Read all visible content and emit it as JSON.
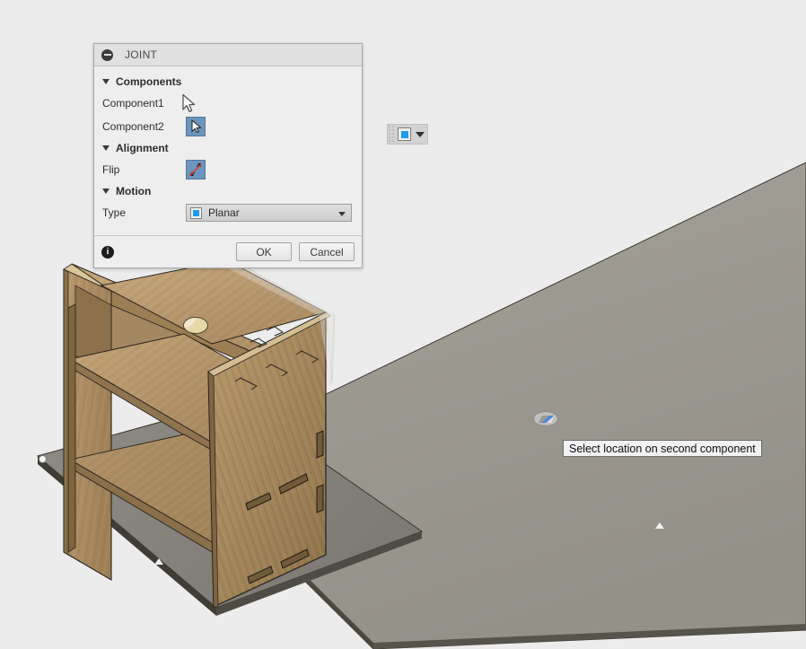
{
  "app": {
    "background_color": "#ececec",
    "viewport_name": "3d-viewport"
  },
  "dialog": {
    "title": "JOINT",
    "collapse_icon": "minus-circle-icon",
    "sections": [
      {
        "id": "components",
        "label": "Components",
        "expanded": true,
        "rows": [
          {
            "id": "component1",
            "label": "Component1",
            "control": "selection-button",
            "selected": false
          },
          {
            "id": "component2",
            "label": "Component2",
            "control": "selection-button",
            "selected": true,
            "icon": "cursor-arrow-icon"
          }
        ]
      },
      {
        "id": "alignment",
        "label": "Alignment",
        "expanded": true,
        "rows": [
          {
            "id": "flip",
            "label": "Flip",
            "control": "toggle-button",
            "icon": "flip-arrows-icon"
          }
        ]
      },
      {
        "id": "motion",
        "label": "Motion",
        "expanded": true,
        "rows": [
          {
            "id": "type",
            "label": "Type",
            "control": "dropdown",
            "value": "Planar",
            "icon": "planar-joint-icon"
          }
        ]
      }
    ],
    "footer": {
      "info_icon": "info-icon",
      "info_glyph": "i",
      "ok_label": "OK",
      "cancel_label": "Cancel"
    },
    "accent_color": "#6c96bd",
    "highlight_color": "#1e9bf0"
  },
  "mini_toolbar": {
    "name": "joint-type-mini-toolbar",
    "grip": "drag-grip",
    "button_icon": "planar-joint-icon",
    "dropdown_icon": "chevron-down-icon"
  },
  "tooltip": {
    "text": "Select location on second component"
  },
  "markers": {
    "second_component_snap": "joint-origin-marker",
    "first_component_snap": "planar-joint-glyph",
    "edge_endpoint": "endpoint-snap-dot",
    "midpoint": "midpoint-snap-triangle"
  },
  "model": {
    "name": "plywood-shelf-assembly",
    "material": "plywood",
    "ground_plane_color": "#9b9890",
    "wood_colors": [
      "#c3a373",
      "#b4946a",
      "#a8885d",
      "#9a7c55",
      "#8b7049"
    ]
  }
}
